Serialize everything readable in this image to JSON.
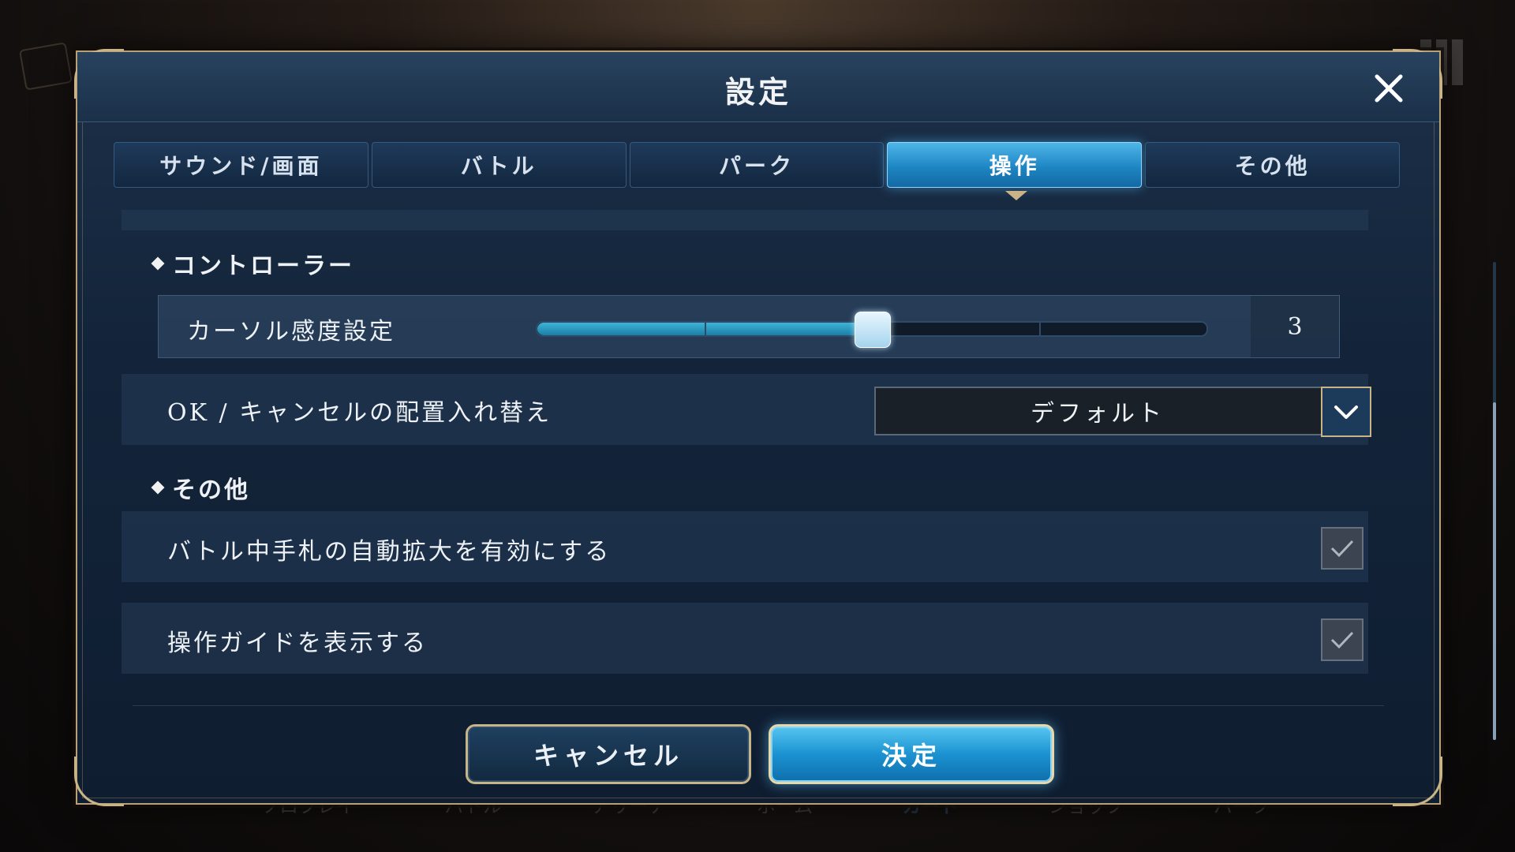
{
  "modal": {
    "title": "設定",
    "close_icon": "close-icon"
  },
  "tabs": [
    {
      "label": "サウンド/画面",
      "active": false
    },
    {
      "label": "バトル",
      "active": false
    },
    {
      "label": "パーク",
      "active": false
    },
    {
      "label": "操作",
      "active": true
    },
    {
      "label": "その他",
      "active": false
    }
  ],
  "sections": {
    "controller": {
      "header": "コントローラー",
      "cursor_sensitivity": {
        "label": "カーソル感度設定",
        "value": "3",
        "level": 3,
        "min": 1,
        "max": 5
      },
      "ok_cancel_swap": {
        "label": "OK / キャンセルの配置入れ替え",
        "selected": "デフォルト"
      }
    },
    "other": {
      "header": "その他",
      "auto_enlarge": {
        "label": "バトル中手札の自動拡大を有効にする",
        "checked": true
      },
      "show_guide": {
        "label": "操作ガイドを表示する",
        "checked": true
      }
    }
  },
  "footer": {
    "cancel_label": "キャンセル",
    "ok_label": "決定"
  },
  "background_nav": [
    "ソロプレイ",
    "バトル",
    "アリーナ",
    "ホーム",
    "カード",
    "ショップ",
    "パーク"
  ],
  "colors": {
    "accent": "#1e86c4",
    "gold_border": "#c9b487",
    "panel": "#13243a"
  }
}
